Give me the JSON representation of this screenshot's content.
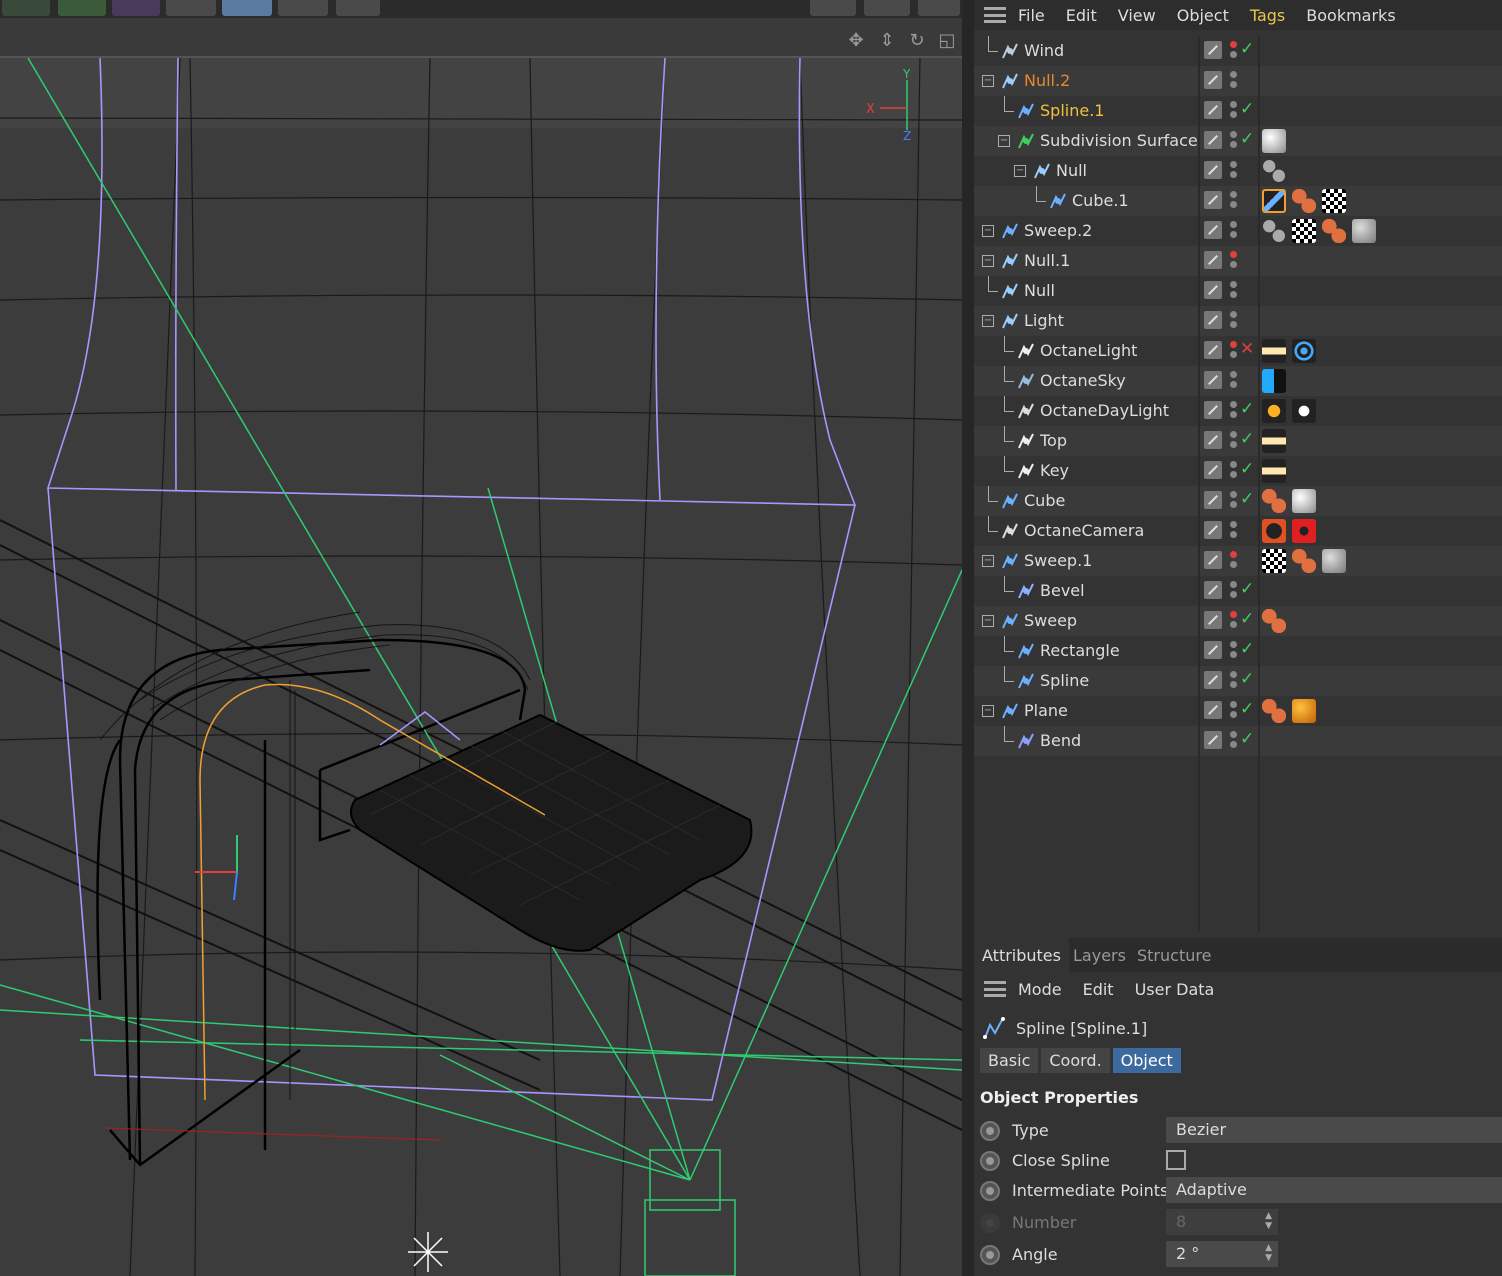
{
  "om_menu": {
    "items": [
      "File",
      "Edit",
      "View",
      "Object",
      "Tags",
      "Bookmarks"
    ],
    "active": "Tags"
  },
  "objects": [
    {
      "name": "Wind",
      "icon": "wind-icon",
      "status": "check",
      "dot": "red"
    },
    {
      "name": "Null.2",
      "icon": "null-icon",
      "color": "orange",
      "dot": "gray"
    },
    {
      "name": "Spline.1",
      "icon": "spline-icon",
      "color": "yellow",
      "status": "check"
    },
    {
      "name": "Subdivision Surface",
      "icon": "subdivision-icon",
      "status": "check"
    },
    {
      "name": "Null",
      "icon": "null-icon"
    },
    {
      "name": "Cube.1",
      "icon": "triangle-icon"
    },
    {
      "name": "Sweep.2",
      "icon": "sweep-icon"
    },
    {
      "name": "Null.1",
      "icon": "null-icon",
      "dot": "red"
    },
    {
      "name": "Null",
      "icon": "null-icon"
    },
    {
      "name": "Light",
      "icon": "null-icon"
    },
    {
      "name": "OctaneLight",
      "icon": "light-icon",
      "status": "cross",
      "dot": "red"
    },
    {
      "name": "OctaneSky",
      "icon": "sky-icon"
    },
    {
      "name": "OctaneDayLight",
      "icon": "daylight-icon",
      "status": "check"
    },
    {
      "name": "Top",
      "icon": "light-icon",
      "status": "check"
    },
    {
      "name": "Key",
      "icon": "light-icon",
      "status": "check"
    },
    {
      "name": "Cube",
      "icon": "cube-icon",
      "status": "check"
    },
    {
      "name": "OctaneCamera",
      "icon": "camera-icon"
    },
    {
      "name": "Sweep.1",
      "icon": "sweep-icon",
      "dot": "red"
    },
    {
      "name": "Bevel",
      "icon": "bevel-icon",
      "status": "check"
    },
    {
      "name": "Sweep",
      "icon": "sweep-icon",
      "status": "check",
      "dot": "red"
    },
    {
      "name": "Rectangle",
      "icon": "spline-icon",
      "status": "check"
    },
    {
      "name": "Spline",
      "icon": "spline-icon",
      "status": "check"
    },
    {
      "name": "Plane",
      "icon": "plane-icon",
      "status": "check"
    },
    {
      "name": "Bend",
      "icon": "bend-icon",
      "status": "check"
    }
  ],
  "attributes": {
    "tabs": [
      "Attributes",
      "Layers",
      "Structure"
    ],
    "active_tab": "Attributes",
    "menu": [
      "Mode",
      "Edit",
      "User Data"
    ],
    "object_title": "Spline [Spline.1]",
    "subtabs": [
      "Basic",
      "Coord.",
      "Object"
    ],
    "active_subtab": "Object",
    "section": "Object Properties",
    "props": {
      "type_label": "Type",
      "type_value": "Bezier",
      "close_label": "Close Spline",
      "intermediate_label": "Intermediate Points",
      "intermediate_value": "Adaptive",
      "number_label": "Number",
      "number_value": "8",
      "angle_label": "Angle",
      "angle_value": "2 °"
    }
  },
  "viewport": {
    "axis_x": "X",
    "axis_y": "Y",
    "axis_z": "Z"
  },
  "colors": {
    "accent_tag": "#e8c64a",
    "selected_orange": "#e8872e",
    "selected_yellow": "#f0c040",
    "check_green": "#3ecf5a",
    "wire_green": "#2ecc71",
    "wire_purple": "#9f8fff",
    "active_subtab": "#3d6a9e"
  }
}
